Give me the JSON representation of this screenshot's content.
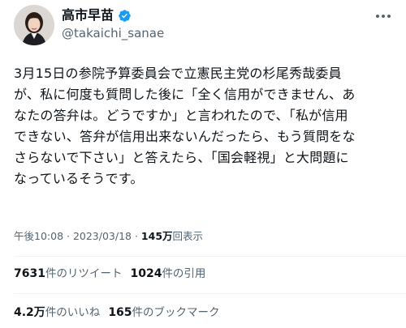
{
  "author": {
    "display_name": "高市早苗",
    "handle": "@takaichi_sanae"
  },
  "tweet": {
    "text": "3月15日の参院予算委員会で立憲民主党の杉尾秀哉委員\nが、私に何度も質問した後に「全く信用ができません、あ\nなたの答弁は。どうですか」と言われたので、「私が信用\nできない、答弁が信用出来ないんだったら、もう質問をな\nさらないで下さい」と答えたら、「国会軽視」と大問題に\nなっているそうです。"
  },
  "meta": {
    "time": "午後10:08",
    "separator": " · ",
    "date": "2023/03/18",
    "views_count": "145万",
    "views_label": "回表示"
  },
  "stats": {
    "retweets_count": "7631",
    "retweets_label": "件のリツイート",
    "quotes_count": "1024",
    "quotes_label": "件の引用",
    "likes_count": "4.2万",
    "likes_label": "件のいいね",
    "bookmarks_count": "165",
    "bookmarks_label": "件のブックマーク"
  },
  "colors": {
    "verified_badge": "#1d9bf0",
    "text_primary": "#0f1419",
    "text_secondary": "#536471",
    "divider": "#eff3f4"
  },
  "icons": {
    "verified": "verified-badge-icon",
    "more": "more-options-icon"
  }
}
